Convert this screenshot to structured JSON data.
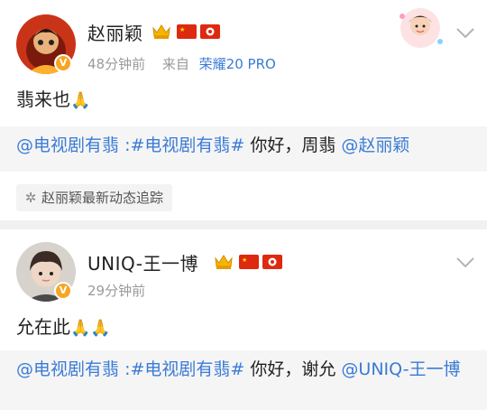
{
  "posts": [
    {
      "user_name": "赵丽颖",
      "time": "48分钟前",
      "source_prefix": "来自",
      "source": "荣耀20 PRO",
      "text": "翡来也",
      "emoji": "🙏",
      "repost": {
        "link1": "@电视剧有翡",
        "link2": ":#电视剧有翡#",
        "plain": " 你好，周翡 ",
        "link3": "@赵丽颖"
      },
      "track_label": "赵丽颖最新动态追踪"
    },
    {
      "user_name": "UNIQ-王一博",
      "time": "29分钟前",
      "text": "允在此",
      "emoji": "🙏🙏",
      "repost": {
        "link1": "@电视剧有翡",
        "link2": ":#电视剧有翡#",
        "plain": " 你好，谢允 ",
        "link3": "@UNIQ-王一博"
      }
    }
  ],
  "icons": {
    "verified": "V",
    "crown": "crown-icon",
    "flag_cn": "china-flag-icon",
    "flag_hk": "hong-kong-flag-icon",
    "chevron": "chevron-down-icon",
    "track": "loading-icon"
  },
  "colors": {
    "link": "#3a7bd5",
    "meta": "#9a9a9a",
    "badge": "#f6a623",
    "flag_red": "#de2910",
    "flag_yellow": "#ffde00"
  }
}
